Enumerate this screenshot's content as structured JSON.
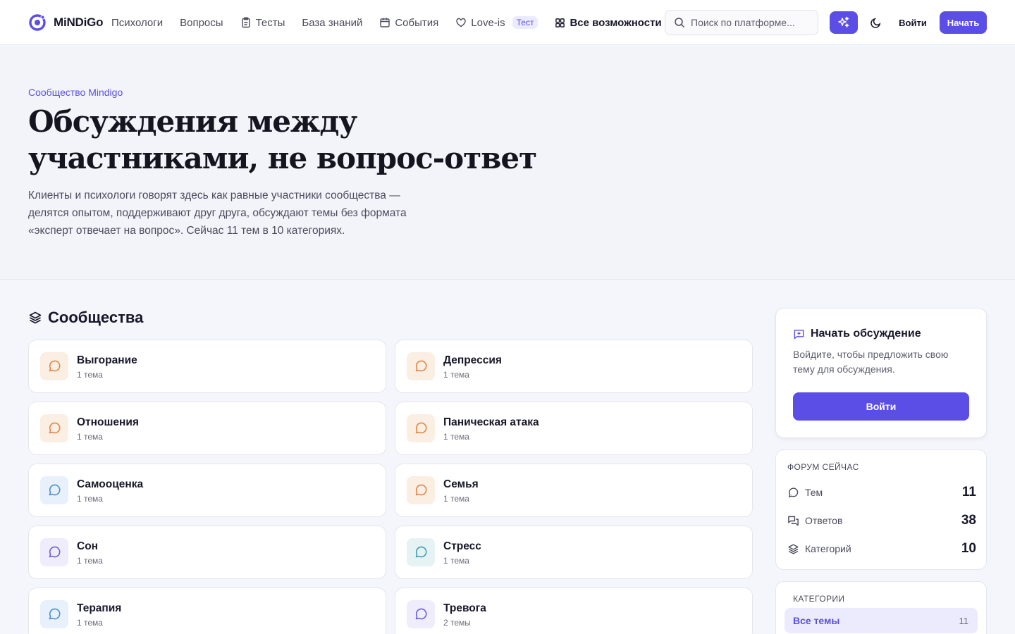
{
  "header": {
    "brand": "MiNDiGo",
    "nav": [
      {
        "label": "Психологи"
      },
      {
        "label": "Вопросы"
      },
      {
        "label": "Тесты",
        "icon": "clipboard-icon"
      },
      {
        "label": "База знаний"
      },
      {
        "label": "События",
        "icon": "calendar-icon"
      },
      {
        "label": "Love-is",
        "icon": "heart-icon",
        "badge": "Тест"
      },
      {
        "label": "Все возможности",
        "icon": "grid-icon"
      }
    ],
    "search_placeholder": "Поиск по платформе...",
    "login": "Войти",
    "start": "Начать"
  },
  "hero": {
    "eyebrow": "Сообщество Mindigo",
    "title": "Обсуждения между участниками, не вопрос-ответ",
    "text": "Клиенты и психологи говорят здесь как равные участники сообщества — делятся опытом, поддерживают друг друга, обсуждают темы без формата «эксперт отвечает на вопрос». Сейчас 11 тем в 10 категориях."
  },
  "communities": {
    "title": "Сообщества",
    "items": [
      {
        "name": "Выгорание",
        "count": "1 тема",
        "color": "orange"
      },
      {
        "name": "Депрессия",
        "count": "1 тема",
        "color": "orange"
      },
      {
        "name": "Отношения",
        "count": "1 тема",
        "color": "orange"
      },
      {
        "name": "Паническая атака",
        "count": "1 тема",
        "color": "orange"
      },
      {
        "name": "Самооценка",
        "count": "1 тема",
        "color": "blue"
      },
      {
        "name": "Семья",
        "count": "1 тема",
        "color": "orange"
      },
      {
        "name": "Сон",
        "count": "1 тема",
        "color": "purple"
      },
      {
        "name": "Стресс",
        "count": "1 тема",
        "color": "teal"
      },
      {
        "name": "Терапия",
        "count": "1 тема",
        "color": "blue"
      },
      {
        "name": "Тревога",
        "count": "2 темы",
        "color": "purple"
      }
    ]
  },
  "start_panel": {
    "title": "Начать обсуждение",
    "text": "Войдите, чтобы предложить свою тему для обсуждения.",
    "button": "Войти"
  },
  "stats": {
    "title": "ФОРУМ СЕЙЧАС",
    "items": [
      {
        "label": "Тем",
        "value": "11"
      },
      {
        "label": "Ответов",
        "value": "38"
      },
      {
        "label": "Категорий",
        "value": "10"
      }
    ]
  },
  "categories": {
    "title": "КАТЕГОРИИ",
    "items": [
      {
        "name": "Все темы",
        "count": "11"
      }
    ]
  },
  "colors": {
    "accent": "#5b4ee6",
    "orange": "#e0884a",
    "blue": "#4a8fd6",
    "purple": "#6a5fe0",
    "teal": "#3f9db0"
  }
}
